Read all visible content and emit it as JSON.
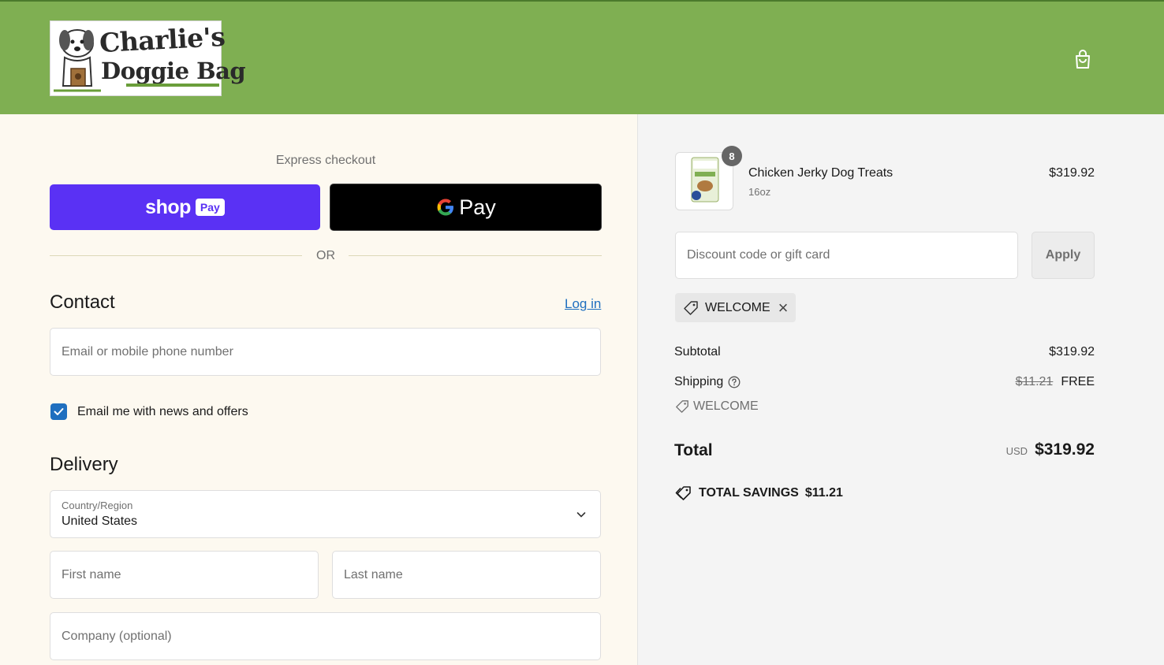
{
  "header": {
    "brand_line1": "Charlie's",
    "brand_line2": "Doggie Bag",
    "colors": {
      "header_bg": "#7faf52"
    },
    "cart_icon": "shopping-bag-icon"
  },
  "express": {
    "label": "Express checkout",
    "shop_pay": {
      "word": "shop",
      "pill": "Pay",
      "color": "#5a31f4"
    },
    "gpay": {
      "label": "Pay"
    },
    "or_text": "OR"
  },
  "contact": {
    "title": "Contact",
    "login_link": "Log in",
    "email_placeholder": "Email or mobile phone number",
    "newsletter_label": "Email me with news and offers",
    "newsletter_checked": true
  },
  "delivery": {
    "title": "Delivery",
    "country_label": "Country/Region",
    "country_value": "United States",
    "first_name_placeholder": "First name",
    "last_name_placeholder": "Last name",
    "company_placeholder": "Company (optional)"
  },
  "summary": {
    "product": {
      "name": "Chicken Jerky Dog Treats",
      "variant": "16oz",
      "price": "$319.92",
      "quantity": "8"
    },
    "discount_placeholder": "Discount code or gift card",
    "apply_label": "Apply",
    "applied_code": "WELCOME",
    "subtotal_label": "Subtotal",
    "subtotal_value": "$319.92",
    "shipping_label": "Shipping",
    "shipping_original": "$11.21",
    "shipping_value": "FREE",
    "shipping_discount_code": "WELCOME",
    "total_label": "Total",
    "currency": "USD",
    "total_value": "$319.92",
    "savings_label": "TOTAL SAVINGS",
    "savings_value": "$11.21"
  }
}
